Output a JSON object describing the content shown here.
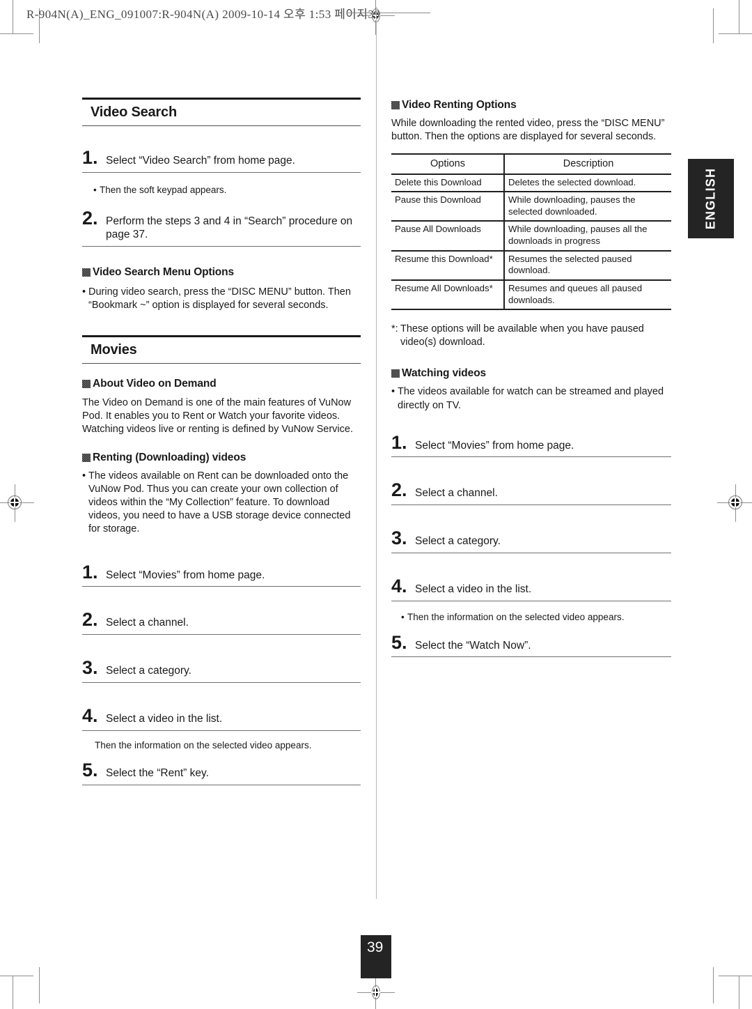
{
  "scan": {
    "header_line": "R-904N(A)_ENG_091007:R-904N(A)  2009-10-14  오후 1:53  페이지39"
  },
  "side_tab": {
    "label": "ENGLISH"
  },
  "page_number": "39",
  "left_column": {
    "section_title": "Video Search",
    "step1": {
      "num": "1.",
      "text": "Select “Video Search” from home page."
    },
    "note1": {
      "bullet": "•",
      "text": "Then the soft keypad appears."
    },
    "step2": {
      "num": "2.",
      "text": "Perform the steps 3 and 4 in “Search” procedure on page  37."
    },
    "menu_options_head": "Video Search Menu Options",
    "menu_options_bullet": {
      "bullet": "•",
      "text": "During video search, press the “DISC MENU” button. Then “Bookmark ~” option is displayed for several seconds."
    },
    "movies_title": "Movies",
    "about_vod_head": "About Video on Demand",
    "about_vod_body": "The Video on Demand is one of the main features of VuNow Pod. It enables you to Rent or Watch your favorite videos. Watching videos live or renting is defined by VuNow Service.",
    "renting_head": "Renting (Downloading) videos",
    "renting_bullet": {
      "bullet": "•",
      "text": "The videos available on Rent can be downloaded onto the VuNow Pod. Thus you can create your own collection of videos within the “My Collection” feature. To download videos, you need to have a USB storage device connected for storage."
    },
    "steps": [
      {
        "num": "1.",
        "text": "Select “Movies” from home page."
      },
      {
        "num": "2.",
        "text": "Select a channel."
      },
      {
        "num": "3.",
        "text": "Select a category."
      },
      {
        "num": "4.",
        "text": "Select a video in the list."
      },
      {
        "num": "5.",
        "text": "Select the “Rent” key."
      }
    ],
    "step4_note": "Then the information on the selected video appears."
  },
  "right_column": {
    "renting_options_head": "Video Renting Options",
    "renting_options_body": "While downloading the rented video, press the “DISC MENU” button. Then the options are displayed for several seconds.",
    "table": {
      "headers": [
        "Options",
        "Description"
      ],
      "rows": [
        {
          "option": "Delete this Download",
          "description": "Deletes the selected download."
        },
        {
          "option": "Pause this Download",
          "description": "While downloading, pauses the selected downloaded."
        },
        {
          "option": "Pause All Downloads",
          "description": "While downloading, pauses all the downloads in progress"
        },
        {
          "option": "Resume this Download*",
          "description": "Resumes the selected paused download."
        },
        {
          "option": "Resume All Downloads*",
          "description": "Resumes and queues all paused downloads."
        }
      ]
    },
    "table_footnote": {
      "mark": "*:",
      "text": "These options will be available when you have paused video(s) download."
    },
    "watching_head": "Watching videos",
    "watching_bullet": {
      "bullet": "•",
      "text": "The videos available for watch can be streamed and played directly on TV."
    },
    "steps": [
      {
        "num": "1.",
        "text": "Select “Movies” from home page."
      },
      {
        "num": "2.",
        "text": "Select a channel."
      },
      {
        "num": "3.",
        "text": "Select a category."
      },
      {
        "num": "4.",
        "text": "Select a video in the list."
      },
      {
        "num": "5.",
        "text": "Select the “Watch Now”."
      }
    ],
    "step4_note": {
      "bullet": "•",
      "text": "Then the information on the selected video appears."
    }
  }
}
